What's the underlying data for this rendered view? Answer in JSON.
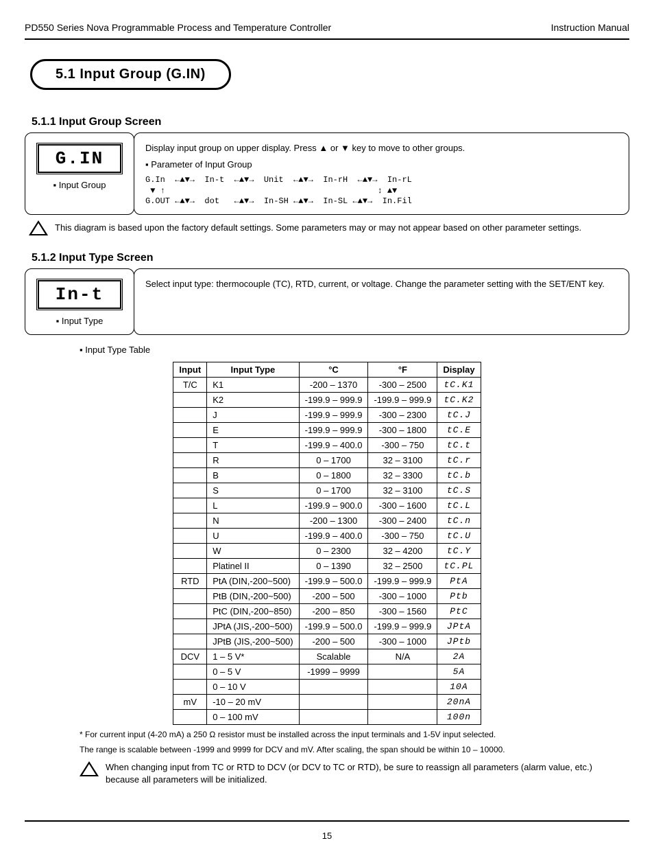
{
  "header": {
    "left": "PD550 Series Nova Programmable Process and Temperature Controller",
    "right": "Instruction Manual"
  },
  "sectionTitle": "5.1 Input Group (G.IN)",
  "groupPara": "5.1.1 Input Group Screen",
  "groupLcd": {
    "code": "G.IN",
    "label": "▪ Input Group"
  },
  "groupDesc": {
    "line1": "Display input group on upper display. Press ▲ or ▼ key to move to other groups.",
    "line2": "▪ Parameter of Input Group"
  },
  "diagram": "G.In  ←▲▼→  In-t  ←▲▼→  Unit  ←▲▼→  In-rH  ←▲▼→  In-rL\n ▼ ↑                                           ↕ ▲▼\nG.OUT ←▲▼→  dot   ←▲▼→  In-SH ←▲▼→  In-SL ←▲▼→  In.Fil",
  "caution1": "This diagram is based upon the factory default settings. Some parameters may or may not appear based on other parameter settings.",
  "typePara": "5.1.2 Input Type Screen",
  "typeLcd": {
    "code": "In-t",
    "label": "▪ Input Type"
  },
  "typeDesc": "Select input type: thermocouple (TC), RTD, current, or voltage. Change the parameter setting with the SET/ENT key.",
  "tableIntro": "▪ Input Type Table",
  "tableHead": [
    "Input",
    "Input Type",
    "°C",
    "°F",
    "Display"
  ],
  "tableRows": [
    {
      "input": "T/C",
      "itype": "K1",
      "c": "-200 – 1370",
      "f": "-300 – 2500",
      "disp": "tC.K1"
    },
    {
      "input": "",
      "itype": "K2",
      "c": "-199.9 – 999.9",
      "f": "-199.9 – 999.9",
      "disp": "tC.K2"
    },
    {
      "input": "",
      "itype": "J",
      "c": "-199.9 – 999.9",
      "f": "-300 – 2300",
      "disp": "tC.J"
    },
    {
      "input": "",
      "itype": "E",
      "c": "-199.9 – 999.9",
      "f": "-300 – 1800",
      "disp": "tC.E"
    },
    {
      "input": "",
      "itype": "T",
      "c": "-199.9 – 400.0",
      "f": "-300 – 750",
      "disp": "tC.t"
    },
    {
      "input": "",
      "itype": "R",
      "c": "0 – 1700",
      "f": "32 – 3100",
      "disp": "tC.r"
    },
    {
      "input": "",
      "itype": "B",
      "c": "0 – 1800",
      "f": "32 – 3300",
      "disp": "tC.b"
    },
    {
      "input": "",
      "itype": "S",
      "c": "0 – 1700",
      "f": "32 – 3100",
      "disp": "tC.S"
    },
    {
      "input": "",
      "itype": "L",
      "c": "-199.9 – 900.0",
      "f": "-300 – 1600",
      "disp": "tC.L"
    },
    {
      "input": "",
      "itype": "N",
      "c": "-200 – 1300",
      "f": "-300 – 2400",
      "disp": "tC.n"
    },
    {
      "input": "",
      "itype": "U",
      "c": "-199.9 – 400.0",
      "f": "-300 – 750",
      "disp": "tC.U"
    },
    {
      "input": "",
      "itype": "W",
      "c": "0 – 2300",
      "f": "32 – 4200",
      "disp": "tC.Y"
    },
    {
      "input": "",
      "itype": "Platinel II",
      "c": "0 – 1390",
      "f": "32 – 2500",
      "disp": "tC.PL"
    },
    {
      "input": "RTD",
      "itype": "PtA (DIN,-200~500)",
      "c": "-199.9 – 500.0",
      "f": "-199.9 – 999.9",
      "disp": "PtA"
    },
    {
      "input": "",
      "itype": "PtB (DIN,-200~500)",
      "c": "-200 – 500",
      "f": "-300 – 1000",
      "disp": "Ptb"
    },
    {
      "input": "",
      "itype": "PtC (DIN,-200~850)",
      "c": "-200 – 850",
      "f": "-300 – 1560",
      "disp": "PtC"
    },
    {
      "input": "",
      "itype": "JPtA (JIS,-200~500)",
      "c": "-199.9 – 500.0",
      "f": "-199.9 – 999.9",
      "disp": "JPtA"
    },
    {
      "input": "",
      "itype": "JPtB (JIS,-200~500)",
      "c": "-200 – 500",
      "f": "-300 – 1000",
      "disp": "JPtb"
    },
    {
      "input": "DCV",
      "itype": "1 – 5 V*",
      "c": "Scalable",
      "f": "N/A",
      "disp": "2A"
    },
    {
      "input": "",
      "itype": "0 – 5 V",
      "c": "-1999 – 9999",
      "f": "",
      "disp": "5A"
    },
    {
      "input": "",
      "itype": "0 – 10 V",
      "c": "",
      "f": "",
      "disp": "10A"
    },
    {
      "input": "mV",
      "itype": "-10 – 20 mV",
      "c": "",
      "f": "",
      "disp": "20nA"
    },
    {
      "input": "",
      "itype": "0 – 100 mV",
      "c": "",
      "f": "",
      "disp": "100n"
    }
  ],
  "tnote1": "* For current input (4-20 mA) a 250 Ω resistor must be installed across the input terminals and 1-5V input selected.",
  "tnote2": "The range is scalable between -1999 and 9999 for DCV and mV. After scaling, the span should be within 10 – 10000.",
  "footCaution": "When changing input from TC or RTD to DCV (or DCV to TC or RTD), be sure to reassign all parameters (alarm value, etc.) because all parameters will be initialized.",
  "pageNum": "15"
}
